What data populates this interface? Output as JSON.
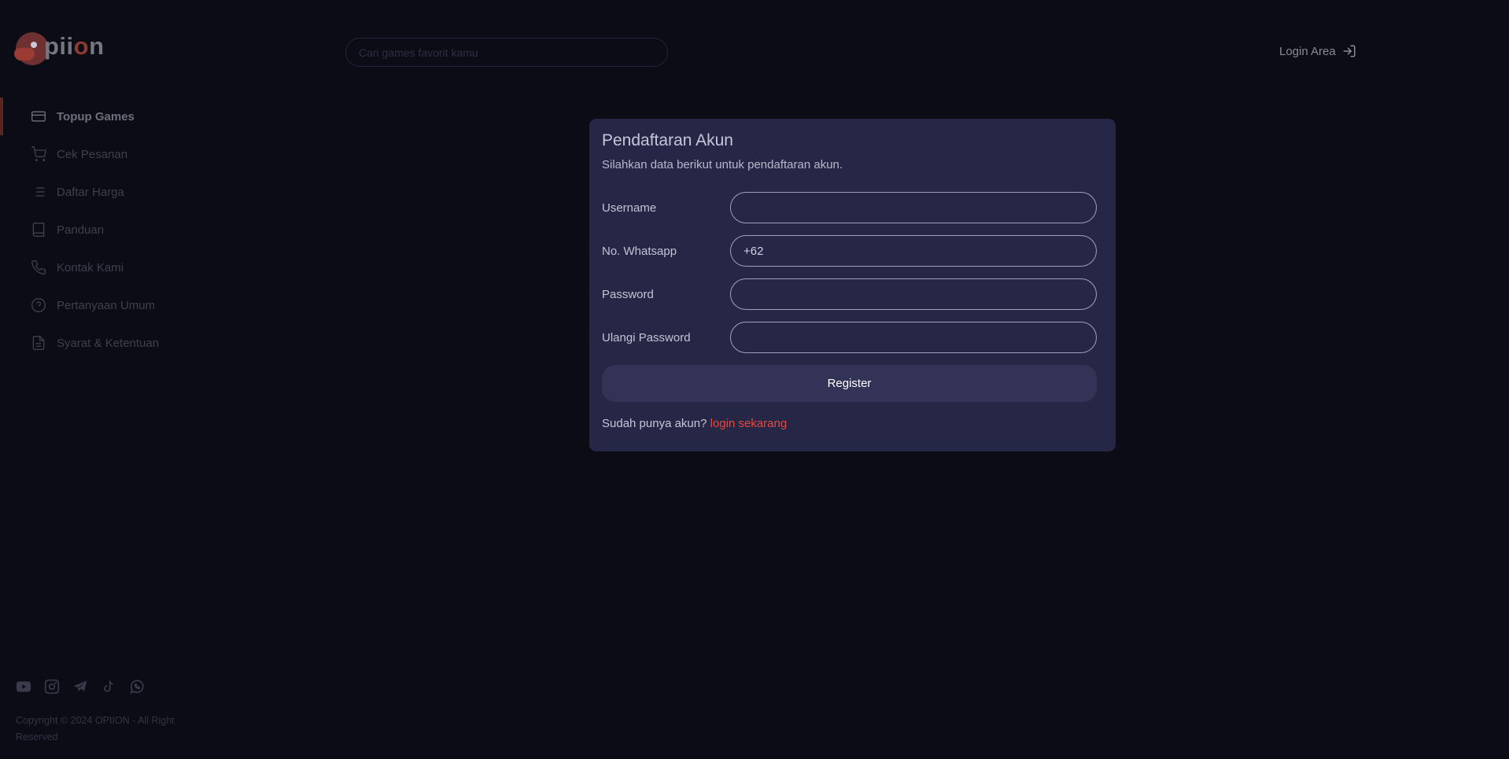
{
  "brand": {
    "logo_text_pre": "pii",
    "logo_text_o": "o",
    "logo_text_post": "n"
  },
  "search": {
    "placeholder": "Cari games favorit kamu"
  },
  "header": {
    "login_label": "Login Area",
    "login_icon": "log-in-icon"
  },
  "sidebar": {
    "items": [
      {
        "label": "Topup Games",
        "icon": "credit-card-icon",
        "active": true
      },
      {
        "label": "Cek Pesanan",
        "icon": "cart-icon",
        "active": false
      },
      {
        "label": "Daftar Harga",
        "icon": "list-icon",
        "active": false
      },
      {
        "label": "Panduan",
        "icon": "book-icon",
        "active": false
      },
      {
        "label": "Kontak Kami",
        "icon": "phone-icon",
        "active": false
      },
      {
        "label": "Pertanyaan Umum",
        "icon": "help-circle-icon",
        "active": false
      },
      {
        "label": "Syarat & Ketentuan",
        "icon": "document-icon",
        "active": false
      }
    ]
  },
  "footer": {
    "socials": [
      "youtube-icon",
      "instagram-icon",
      "telegram-icon",
      "tiktok-icon",
      "whatsapp-icon"
    ],
    "copyright": "Copyright © 2024 OPIION - All Right Reserved"
  },
  "modal": {
    "title": "Pendaftaran Akun",
    "subtitle": "Silahkan data berikut untuk pendaftaran akun.",
    "fields": [
      {
        "label": "Username",
        "value": "",
        "placeholder": ""
      },
      {
        "label": "No. Whatsapp",
        "value": "",
        "placeholder": "+62"
      },
      {
        "label": "Password",
        "value": "",
        "placeholder": ""
      },
      {
        "label": "Ulangi Password",
        "value": "",
        "placeholder": ""
      }
    ],
    "register_label": "Register",
    "have_account_text": "Sudah punya akun?",
    "login_link": "login sekarang"
  },
  "colors": {
    "background": "#0c0c17",
    "modal": "#262647",
    "accent": "#e8473c",
    "button": "#333357"
  }
}
